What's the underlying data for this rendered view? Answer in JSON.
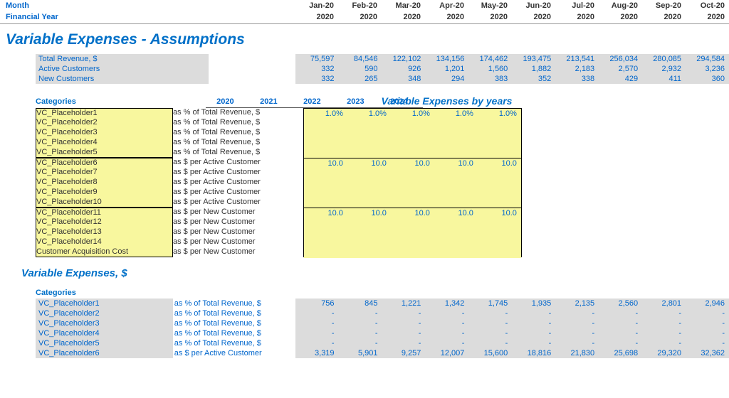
{
  "header": {
    "month": "Month",
    "year": "Financial Year"
  },
  "months": [
    "Jan-20",
    "Feb-20",
    "Mar-20",
    "Apr-20",
    "May-20",
    "Jun-20",
    "Jul-20",
    "Aug-20",
    "Sep-20",
    "Oct-20"
  ],
  "years": [
    "2020",
    "2020",
    "2020",
    "2020",
    "2020",
    "2020",
    "2020",
    "2020",
    "2020",
    "2020"
  ],
  "title": "Variable Expenses - Assumptions",
  "metrics": [
    {
      "name": "Total Revenue, $",
      "values": [
        "75,597",
        "84,546",
        "122,102",
        "134,156",
        "174,462",
        "193,475",
        "213,541",
        "256,034",
        "280,085",
        "294,584"
      ]
    },
    {
      "name": "Active Customers",
      "values": [
        "332",
        "590",
        "926",
        "1,201",
        "1,560",
        "1,882",
        "2,183",
        "2,570",
        "2,932",
        "3,236"
      ]
    },
    {
      "name": "New Customers",
      "values": [
        "332",
        "265",
        "348",
        "294",
        "383",
        "352",
        "338",
        "429",
        "411",
        "360"
      ]
    }
  ],
  "vex_title": "Variable Expenses by years",
  "vex_years": [
    "2020",
    "2021",
    "2022",
    "2023",
    "2024"
  ],
  "categories_label": "Categories",
  "cat_groups": [
    {
      "label": "as % of Total Revenue, $",
      "rows": [
        "VC_Placeholder1",
        "VC_Placeholder2",
        "VC_Placeholder3",
        "VC_Placeholder4",
        "VC_Placeholder5"
      ],
      "yvals": [
        "1.0%",
        "1.0%",
        "1.0%",
        "1.0%",
        "1.0%"
      ]
    },
    {
      "label": "as $ per Active Customer",
      "rows": [
        "VC_Placeholder6",
        "VC_Placeholder7",
        "VC_Placeholder8",
        "VC_Placeholder9",
        "VC_Placeholder10"
      ],
      "yvals": [
        "10.0",
        "10.0",
        "10.0",
        "10.0",
        "10.0"
      ]
    },
    {
      "label": "as $ per New Customer",
      "rows": [
        "VC_Placeholder11",
        "VC_Placeholder12",
        "VC_Placeholder13",
        "VC_Placeholder14",
        "Customer Acquisition Cost"
      ],
      "yvals": [
        "10.0",
        "10.0",
        "10.0",
        "10.0",
        "10.0"
      ]
    }
  ],
  "section2_title": "Variable Expenses, $",
  "expense_rows": [
    {
      "name": "VC_Placeholder1",
      "label": "as % of Total Revenue, $",
      "values": [
        "756",
        "845",
        "1,221",
        "1,342",
        "1,745",
        "1,935",
        "2,135",
        "2,560",
        "2,801",
        "2,946"
      ]
    },
    {
      "name": "VC_Placeholder2",
      "label": "as % of Total Revenue, $",
      "values": [
        "-",
        "-",
        "-",
        "-",
        "-",
        "-",
        "-",
        "-",
        "-",
        "-"
      ]
    },
    {
      "name": "VC_Placeholder3",
      "label": "as % of Total Revenue, $",
      "values": [
        "-",
        "-",
        "-",
        "-",
        "-",
        "-",
        "-",
        "-",
        "-",
        "-"
      ]
    },
    {
      "name": "VC_Placeholder4",
      "label": "as % of Total Revenue, $",
      "values": [
        "-",
        "-",
        "-",
        "-",
        "-",
        "-",
        "-",
        "-",
        "-",
        "-"
      ]
    },
    {
      "name": "VC_Placeholder5",
      "label": "as % of Total Revenue, $",
      "values": [
        "-",
        "-",
        "-",
        "-",
        "-",
        "-",
        "-",
        "-",
        "-",
        "-"
      ]
    },
    {
      "name": "VC_Placeholder6",
      "label": "as $ per Active Customer",
      "values": [
        "3,319",
        "5,901",
        "9,257",
        "12,007",
        "15,600",
        "18,816",
        "21,830",
        "25,698",
        "29,320",
        "32,362"
      ]
    }
  ]
}
